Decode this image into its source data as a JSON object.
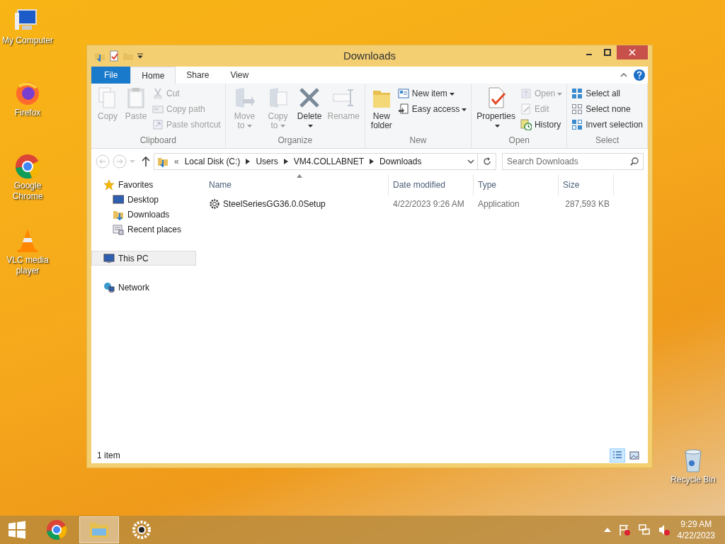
{
  "desktop_icons": [
    {
      "label": "My Computer"
    },
    {
      "label": "Firefox"
    },
    {
      "label": "Google Chrome"
    },
    {
      "label": "VLC media player"
    },
    {
      "label": "Recycle Bin"
    }
  ],
  "window": {
    "title": "Downloads",
    "ribbon_tabs": [
      {
        "label": "File",
        "kind": "file",
        "selected": false
      },
      {
        "label": "Home",
        "kind": "tab",
        "selected": true
      },
      {
        "label": "Share",
        "kind": "tab",
        "selected": false
      },
      {
        "label": "View",
        "kind": "tab",
        "selected": false
      }
    ],
    "ribbon_groups": [
      {
        "label": "Clipboard",
        "items": [
          {
            "kind": "large",
            "label": "Copy",
            "disabled": true,
            "dropdown": false
          },
          {
            "kind": "large",
            "label": "Paste",
            "disabled": true,
            "dropdown": false
          },
          {
            "kind": "small",
            "label": "Cut",
            "disabled": true,
            "dropdown": false
          },
          {
            "kind": "small",
            "label": "Copy path",
            "disabled": true,
            "dropdown": false
          },
          {
            "kind": "small",
            "label": "Paste shortcut",
            "disabled": true,
            "dropdown": false
          }
        ]
      },
      {
        "label": "Organize",
        "items": [
          {
            "kind": "large",
            "label": "Move to",
            "disabled": true,
            "dropdown": true
          },
          {
            "kind": "large",
            "label": "Copy to",
            "disabled": true,
            "dropdown": true
          },
          {
            "kind": "large",
            "label": "Delete",
            "disabled": false,
            "dropdown": true
          },
          {
            "kind": "large",
            "label": "Rename",
            "disabled": true,
            "dropdown": false
          }
        ]
      },
      {
        "label": "New",
        "items": [
          {
            "kind": "large",
            "label": "New folder",
            "disabled": false,
            "dropdown": false
          },
          {
            "kind": "small",
            "label": "New item",
            "disabled": false,
            "dropdown": true
          },
          {
            "kind": "small",
            "label": "Easy access",
            "disabled": false,
            "dropdown": true
          }
        ]
      },
      {
        "label": "Open",
        "items": [
          {
            "kind": "large",
            "label": "Properties",
            "disabled": false,
            "dropdown": true
          },
          {
            "kind": "small",
            "label": "Open",
            "disabled": true,
            "dropdown": true
          },
          {
            "kind": "small",
            "label": "Edit",
            "disabled": true,
            "dropdown": false
          },
          {
            "kind": "small",
            "label": "History",
            "disabled": false,
            "dropdown": false
          }
        ]
      },
      {
        "label": "Select",
        "items": [
          {
            "kind": "small",
            "label": "Select all",
            "disabled": false,
            "dropdown": false
          },
          {
            "kind": "small",
            "label": "Select none",
            "disabled": false,
            "dropdown": false
          },
          {
            "kind": "small",
            "label": "Invert selection",
            "disabled": false,
            "dropdown": false
          }
        ]
      }
    ],
    "address": {
      "overflow": "«",
      "crumbs": [
        "Local Disk (C:)",
        "Users",
        "VM4.COLLABNET",
        "Downloads"
      ],
      "search_placeholder": "Search Downloads"
    },
    "navigation": [
      {
        "label": "Favorites",
        "selected": false,
        "children": [
          {
            "label": "Desktop",
            "selected": false
          },
          {
            "label": "Downloads",
            "selected": false
          },
          {
            "label": "Recent places",
            "selected": false
          }
        ]
      },
      {
        "label": "This PC",
        "selected": true
      },
      {
        "label": "Network",
        "selected": false
      }
    ],
    "columns": [
      "Name",
      "Date modified",
      "Type",
      "Size"
    ],
    "rows": [
      {
        "name": "SteelSeriesGG36.0.0Setup",
        "date_modified": "4/22/2023 9:26 AM",
        "type": "Application",
        "size": "287,593 KB"
      }
    ],
    "status": "1 item",
    "views": [
      {
        "kind": "details",
        "selected": true
      },
      {
        "kind": "thumbnails",
        "selected": false
      }
    ]
  },
  "taskbar": {
    "items": [
      {
        "kind": "chrome",
        "selected": false
      },
      {
        "kind": "explorer",
        "selected": true
      },
      {
        "kind": "steelseries",
        "selected": false
      }
    ],
    "time": "9:29 AM",
    "date": "4/22/2023"
  }
}
